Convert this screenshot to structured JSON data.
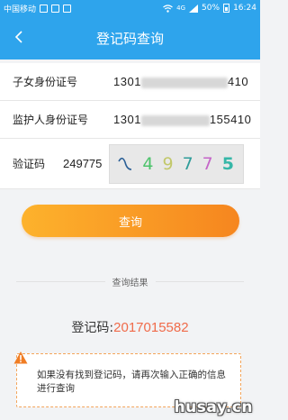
{
  "status_bar": {
    "carrier": "中国移动",
    "signal": "4G",
    "battery": "50%",
    "time": "16:24"
  },
  "nav": {
    "title": "登记码查询",
    "back_icon": "chevron-left-icon"
  },
  "form": {
    "child_id_label": "子女身份证号",
    "child_id_prefix": "1301",
    "child_id_suffix": "410",
    "guardian_id_label": "监护人身份证号",
    "guardian_id_prefix": "1301",
    "guardian_id_suffix": "155410",
    "captcha_label": "验证码",
    "captcha_value": "249775",
    "captcha_image_chars": [
      "4",
      "9",
      "7",
      "7",
      "5"
    ],
    "captcha_image_colors": [
      "#4cc36b",
      "#c2c86a",
      "#2f9d9a",
      "#c565c8",
      "#36b7a8"
    ]
  },
  "query_button_label": "查询",
  "result": {
    "section_title": "查询结果",
    "code_label": "登记码:",
    "code_value": "2017015582"
  },
  "notice": {
    "icon": "warning-triangle-icon",
    "text": "如果没有找到登记码，请再次输入正确的信息进行查询"
  },
  "watermark": "husay.cn",
  "colors": {
    "primary": "#2ea4ec",
    "button_start": "#fdb22c",
    "button_end": "#f6861f",
    "code": "#f06b4a"
  }
}
